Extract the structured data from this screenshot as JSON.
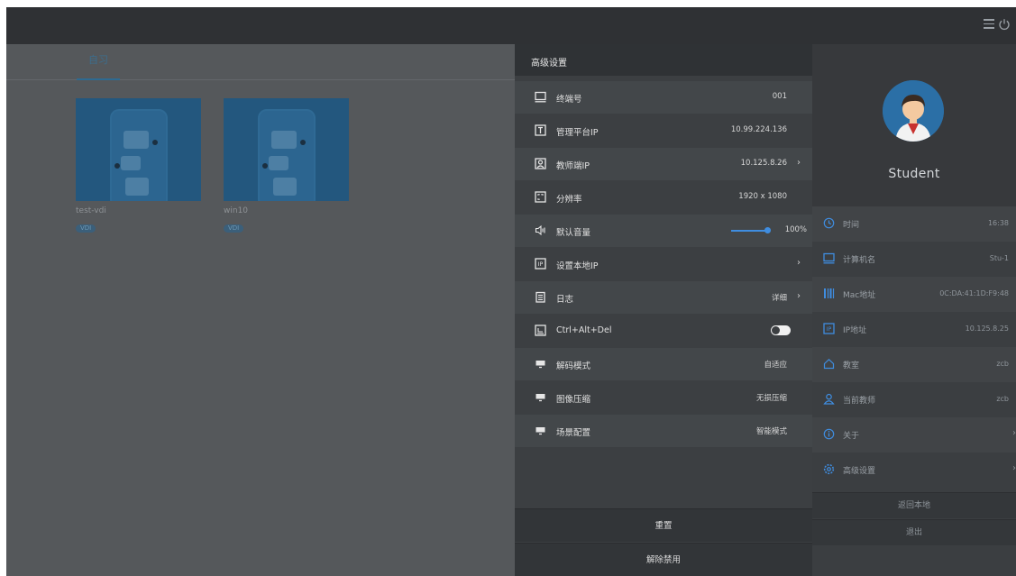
{
  "topbar": {
    "menu_icon": "hamburger-menu-icon",
    "power_icon": "power-icon"
  },
  "left": {
    "tab_label": "自习",
    "desktops": [
      {
        "name": "test-vdi",
        "badge": "VDI"
      },
      {
        "name": "win10",
        "badge": "VDI"
      }
    ]
  },
  "advanced": {
    "title": "高级设置",
    "rows": [
      {
        "icon": "monitor-icon",
        "label": "终端号",
        "value": "001",
        "chevron": ""
      },
      {
        "icon": "platform-icon",
        "label": "管理平台IP",
        "value": "10.99.224.136",
        "chevron": ""
      },
      {
        "icon": "teacher-icon",
        "label": "教师端IP",
        "value": "10.125.8.26",
        "chevron": "›"
      },
      {
        "icon": "resolution-icon",
        "label": "分辨率",
        "value": "1920 x 1080",
        "chevron": ""
      },
      {
        "icon": "speaker-icon",
        "label": "默认音量",
        "value": "100%",
        "chevron": ""
      },
      {
        "icon": "ip-icon",
        "label": "设置本地IP",
        "value": "",
        "chevron": "›"
      },
      {
        "icon": "log-icon",
        "label": "日志",
        "value": "详细",
        "chevron": "›"
      },
      {
        "icon": "keyboard-icon",
        "label": "Ctrl+Alt+Del",
        "value": "",
        "chevron": ""
      },
      {
        "icon": "decode-icon",
        "label": "解码模式",
        "value": "自适应",
        "chevron": ""
      },
      {
        "icon": "compress-icon",
        "label": "图像压缩",
        "value": "无损压缩",
        "chevron": ""
      },
      {
        "icon": "scene-icon",
        "label": "场景配置",
        "value": "智能模式",
        "chevron": ""
      }
    ],
    "volume_level": 1.0,
    "ctrl_alt_del_enabled": true,
    "reset_label": "重置",
    "unban_label": "解除禁用"
  },
  "user": {
    "name": "Student",
    "rows": [
      {
        "icon": "clock-icon",
        "label": "时间",
        "value": "16:38",
        "chevron": ""
      },
      {
        "icon": "computer-icon",
        "label": "计算机名",
        "value": "Stu-1",
        "chevron": ""
      },
      {
        "icon": "mac-icon",
        "label": "Mac地址",
        "value": "0C:DA:41:1D:F9:48",
        "chevron": ""
      },
      {
        "icon": "ip-address-icon",
        "label": "IP地址",
        "value": "10.125.8.25",
        "chevron": ""
      },
      {
        "icon": "classroom-icon",
        "label": "教室",
        "value": "zcb",
        "chevron": ""
      },
      {
        "icon": "teacher-user-icon",
        "label": "当前教师",
        "value": "zcb",
        "chevron": ""
      },
      {
        "icon": "info-icon",
        "label": "关于",
        "value": "",
        "chevron": "›"
      },
      {
        "icon": "settings-icon",
        "label": "高级设置",
        "value": "",
        "chevron": "›"
      }
    ],
    "return_local_label": "返回本地",
    "exit_label": "退出"
  },
  "colors": {
    "accent": "#3f8de0",
    "panel": "#3c3f42",
    "sidebar": "#3b3e41"
  }
}
